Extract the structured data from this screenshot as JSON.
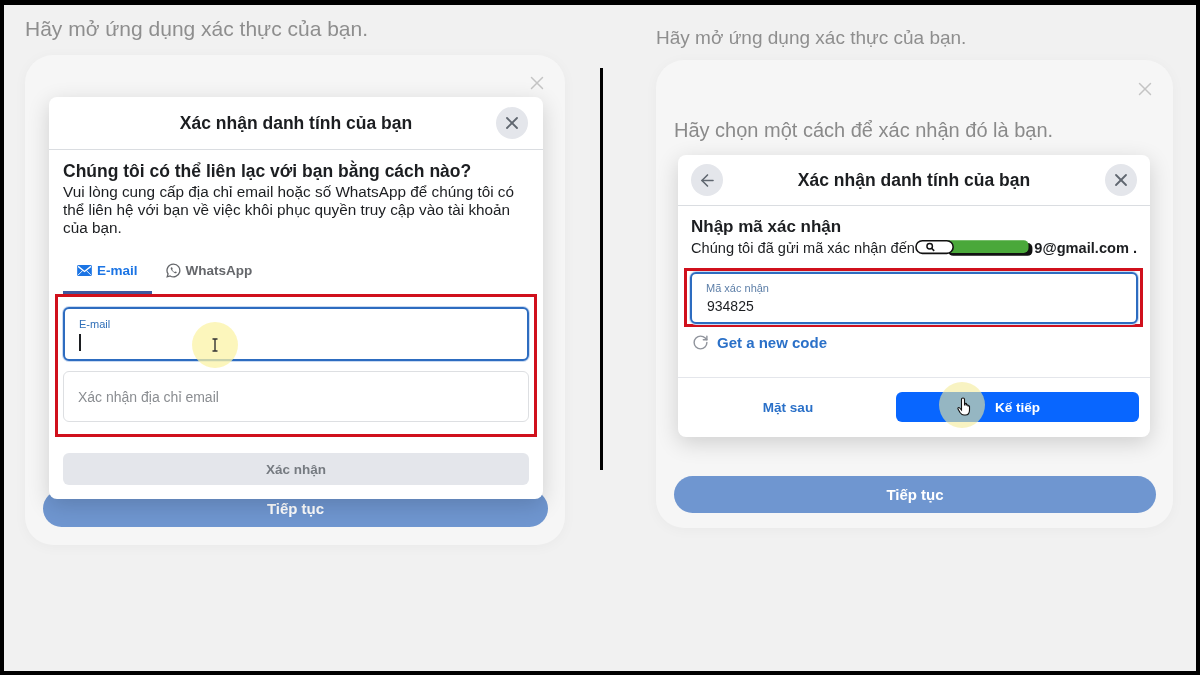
{
  "left_screen": {
    "background": {
      "heading": "Hãy mở ứng dụng xác thực của bạn.",
      "button": "Tiếp tục"
    },
    "dialog": {
      "title": "Xác nhận danh tính của bạn",
      "question": "Chúng tôi có thể liên lạc với bạn bằng cách nào?",
      "description": "Vui lòng cung cấp địa chỉ email hoặc số WhatsApp để chúng tôi có thể liên hệ với bạn về việc khôi phục quyền truy cập vào tài khoản của bạn.",
      "tabs": [
        {
          "label": "E-mail",
          "kind": "email",
          "selected": true
        },
        {
          "label": "WhatsApp",
          "kind": "whatsapp",
          "selected": false
        }
      ],
      "fields": [
        {
          "label": "E-mail",
          "focused": true
        },
        {
          "placeholder": "Xác nhận địa chỉ email",
          "focused": false
        }
      ],
      "button": {
        "label": "Xác nhận",
        "disabled": true
      }
    }
  },
  "right_screen": {
    "background": {
      "heading": "Hãy mở ứng dụng xác thực của bạn.",
      "subheading": "Hãy chọn một cách để xác nhận đó là bạn.",
      "button": "Tiếp tục"
    },
    "dialog": {
      "title": "Xác nhận danh tính của bạn",
      "heading": "Nhập mã xác nhận",
      "sent_text": "Chúng tôi đã gửi mã xác nhận đến",
      "email_end": "9@gmail.com .",
      "field": {
        "label": "Mã xác nhận",
        "value": "934825",
        "focused": true
      },
      "link": "Get a new code",
      "buttons": [
        {
          "label": "Mặt sau",
          "kind": "text"
        },
        {
          "label": "Kế tiếp",
          "kind": "primary"
        }
      ]
    }
  }
}
